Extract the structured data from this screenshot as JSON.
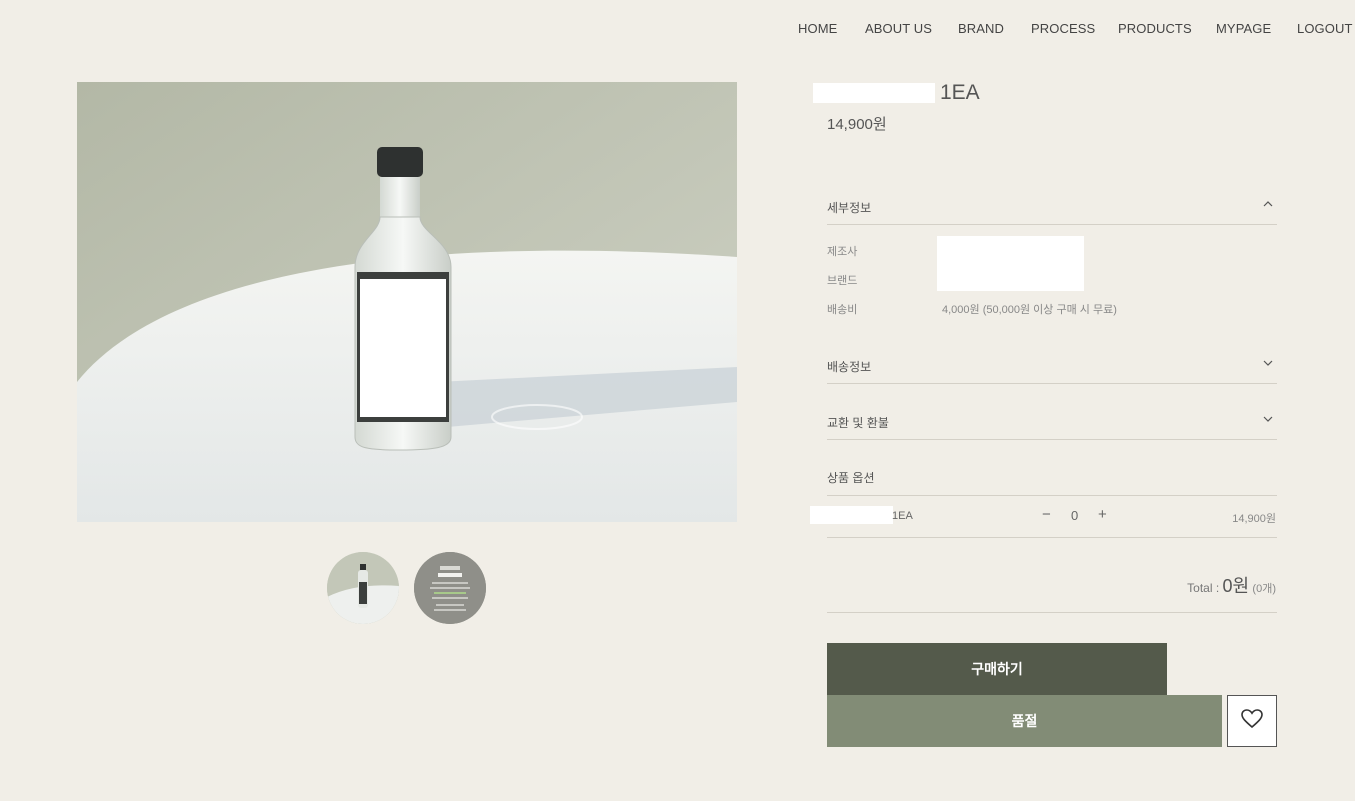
{
  "nav": {
    "home": "HOME",
    "about": "ABOUT US",
    "brand": "BRAND",
    "process": "PROCESS",
    "products": "PRODUCTS",
    "mypage": "MYPAGE",
    "logout": "LOGOUT"
  },
  "product": {
    "title_suffix": "1EA",
    "price": "14,900원"
  },
  "details": {
    "section_label": "세부정보",
    "rows": [
      {
        "label": "제조사",
        "value": ""
      },
      {
        "label": "브랜드",
        "value": ""
      },
      {
        "label": "배송비",
        "value": "4,000원 (50,000원 이상 구매 시 무료)"
      }
    ]
  },
  "shipping": {
    "label": "배송정보"
  },
  "refund": {
    "label": "교환 및 환불"
  },
  "options": {
    "title": "상품 옵션",
    "item_name": "1EA",
    "minus": "−",
    "plus": "+",
    "quantity": "0",
    "item_price": "14,900원"
  },
  "total": {
    "label": "Total : ",
    "amount": "0원",
    "count": "(0개)"
  },
  "buttons": {
    "buy": "구매하기",
    "soldout": "품절"
  },
  "icons": {
    "chevron_up": "chevron-up-icon",
    "chevron_down": "chevron-down-icon",
    "heart": "heart-icon"
  },
  "colors": {
    "background": "#f1eee7",
    "buy_button": "#545a4b",
    "soldout_button": "#828c76"
  }
}
